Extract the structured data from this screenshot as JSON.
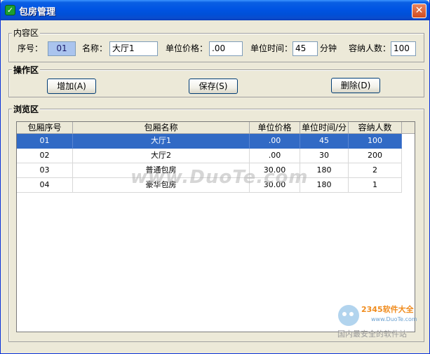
{
  "window": {
    "title": "包房管理",
    "title_icon": "check-icon",
    "close_label": "✕"
  },
  "content_group": {
    "legend": "内容区",
    "serial_label": "序号：",
    "serial_value": "01",
    "name_label": "名称：",
    "name_value": "大厅1",
    "price_label": "单位价格：",
    "price_value": ".00",
    "unit_time_label": "单位时间：",
    "unit_time_value": "45",
    "minute_label": "分钟",
    "capacity_label": "容纳人数：",
    "capacity_value": "100"
  },
  "ops_group": {
    "legend": "操作区",
    "add_label": "增加(A)",
    "save_label": "保存(S)",
    "delete_label": "删除(D)"
  },
  "browse_group": {
    "legend": "浏览区",
    "columns": [
      "包厢序号",
      "包厢名称",
      "单位价格",
      "单位时间/分",
      "容纳人数"
    ],
    "rows": [
      [
        "01",
        "大厅1",
        ".00",
        "45",
        "100"
      ],
      [
        "02",
        "大厅2",
        ".00",
        "30",
        "200"
      ],
      [
        "03",
        "普通包房",
        "30.00",
        "180",
        "2"
      ],
      [
        "04",
        "豪华包房",
        "30.00",
        "180",
        "1"
      ]
    ],
    "selected_row": 0
  },
  "watermark": {
    "text": "www.DuoTe.com"
  },
  "logo": {
    "brand": "2345软件大全",
    "url": "www.DuoTe.com",
    "slogan": "国内最安全的软件站"
  },
  "colors": {
    "title_bar": "#0054e3",
    "selection": "#316ac5",
    "window_bg": "#ece9d8"
  }
}
